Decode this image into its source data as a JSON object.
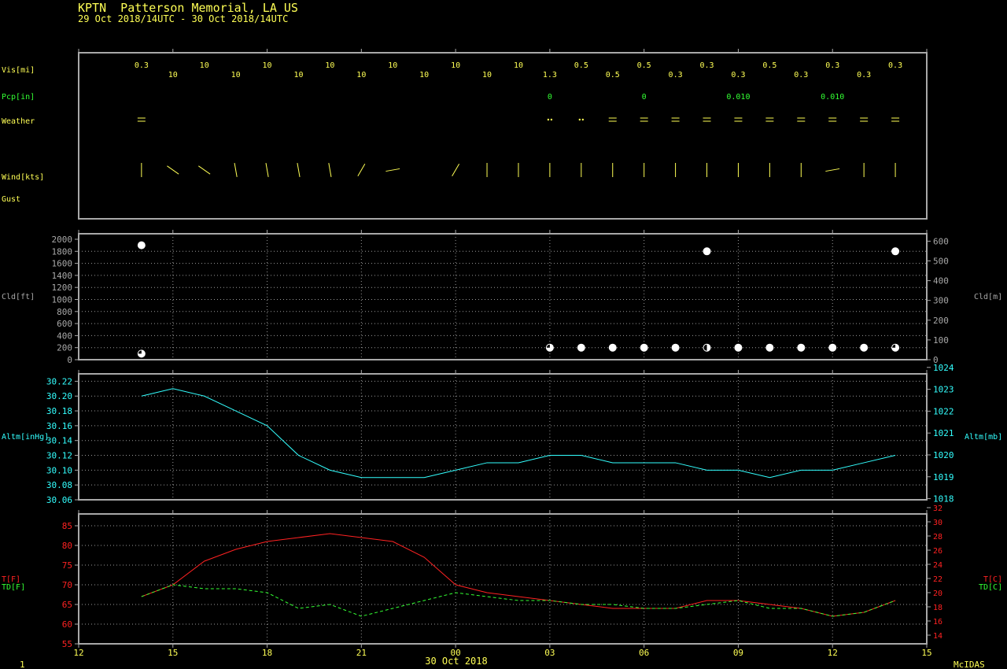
{
  "header": {
    "title": "KPTN  Patterson Memorial, LA US",
    "subtitle": "29 Oct 2018/14UTC - 30 Oct 2018/14UTC"
  },
  "footer": {
    "page": "1",
    "date": "30 Oct 2018",
    "brand": "McIDAS"
  },
  "colors": {
    "yellow": "#ffff55",
    "green": "#33ff33",
    "cyan": "#33ffff",
    "red": "#ff2222",
    "frame": "#a8a8a8"
  },
  "chart_data": [
    {
      "type": "table",
      "name": "surface-obs",
      "x_hours": [
        14,
        15,
        16,
        17,
        18,
        19,
        20,
        21,
        22,
        23,
        24,
        25,
        26,
        27,
        28,
        29,
        30,
        31,
        32,
        33,
        34,
        35,
        36,
        37,
        38
      ],
      "rows": [
        {
          "label": "Vis[mi]",
          "values": [
            "0.3",
            "10",
            "10",
            "10",
            "10",
            "10",
            "10",
            "10",
            "10",
            "10",
            "10",
            "10",
            "10",
            "1.3",
            "0.5",
            "0.5",
            "0.5",
            "0.3",
            "0.3",
            "0.3",
            "0.5",
            "0.3",
            "0.3",
            "0.3",
            "0.3"
          ]
        },
        {
          "label": "Pcp[in]",
          "values": [
            "",
            "",
            "",
            "",
            "",
            "",
            "",
            "",
            "",
            "",
            "",
            "",
            "",
            "0",
            "",
            "",
            "0",
            "",
            "",
            "0.010",
            "",
            "",
            "0.010",
            "",
            ""
          ]
        },
        {
          "label": "Weather",
          "values": [
            "fog",
            "",
            "",
            "",
            "",
            "",
            "",
            "",
            "",
            "",
            "",
            "",
            "",
            "drizzle",
            "drizzle",
            "fog",
            "fog",
            "fog",
            "fog",
            "fog",
            "fog",
            "fog",
            "fog",
            "fog",
            "fog"
          ]
        },
        {
          "label": "Wind[kts]",
          "values": []
        },
        {
          "label": "Gust",
          "values": []
        }
      ],
      "wind_dir_deg": [
        0,
        125,
        125,
        350,
        350,
        350,
        350,
        30,
        80,
        null,
        210,
        0,
        0,
        0,
        0,
        0,
        0,
        0,
        0,
        0,
        0,
        0,
        80,
        0,
        0
      ]
    },
    {
      "type": "scatter",
      "name": "cloud",
      "ylabel_left": "Cld[ft]",
      "ylabel_right": "Cld[m]",
      "ylim": [
        0,
        2000
      ],
      "yticks_left": [
        0,
        200,
        400,
        600,
        800,
        1000,
        1200,
        1400,
        1600,
        1800,
        2000
      ],
      "yticks_right": [
        0,
        100,
        200,
        300,
        400,
        500,
        600
      ],
      "points": [
        {
          "x": 14,
          "y": 1900,
          "cover": "full"
        },
        {
          "x": 14,
          "y": 100,
          "cover": "three-quarter"
        },
        {
          "x": 27,
          "y": 200,
          "cover": "three-quarter"
        },
        {
          "x": 28,
          "y": 200,
          "cover": "full"
        },
        {
          "x": 29,
          "y": 200,
          "cover": "full"
        },
        {
          "x": 30,
          "y": 200,
          "cover": "full"
        },
        {
          "x": 31,
          "y": 200,
          "cover": "full"
        },
        {
          "x": 32,
          "y": 200,
          "cover": "half"
        },
        {
          "x": 32,
          "y": 1800,
          "cover": "full"
        },
        {
          "x": 33,
          "y": 200,
          "cover": "full"
        },
        {
          "x": 34,
          "y": 200,
          "cover": "full"
        },
        {
          "x": 35,
          "y": 200,
          "cover": "full"
        },
        {
          "x": 36,
          "y": 200,
          "cover": "full"
        },
        {
          "x": 37,
          "y": 200,
          "cover": "full"
        },
        {
          "x": 38,
          "y": 200,
          "cover": "three-quarter"
        },
        {
          "x": 38,
          "y": 1800,
          "cover": "full"
        }
      ]
    },
    {
      "type": "line",
      "name": "altimeter",
      "ylabel_left": "Altm[inHg]",
      "ylabel_right": "Altm[mb]",
      "ylim": [
        30.06,
        30.23
      ],
      "yticks_left": [
        "30.06",
        "30.08",
        "30.10",
        "30.12",
        "30.14",
        "30.16",
        "30.18",
        "30.20",
        "30.22"
      ],
      "yticks_right": [
        "1018",
        "1019",
        "1020",
        "1021",
        "1022",
        "1023",
        "1024"
      ],
      "x": [
        14,
        15,
        16,
        17,
        18,
        19,
        20,
        21,
        22,
        23,
        24,
        25,
        26,
        27,
        28,
        29,
        30,
        31,
        32,
        33,
        34,
        35,
        36,
        37,
        38
      ],
      "values": [
        30.2,
        30.21,
        30.2,
        30.18,
        30.16,
        30.12,
        30.1,
        30.09,
        30.09,
        30.09,
        30.1,
        30.11,
        30.11,
        30.12,
        30.12,
        30.11,
        30.11,
        30.11,
        30.1,
        30.1,
        30.09,
        30.1,
        30.1,
        30.11,
        30.12
      ]
    },
    {
      "type": "line",
      "name": "temperature",
      "ylabel_left": [
        "T[F]",
        "TD[F]"
      ],
      "ylabel_right": [
        "T[C]",
        "TD[C]"
      ],
      "ylim": [
        55,
        88
      ],
      "yticks_left": [
        "55",
        "60",
        "65",
        "70",
        "75",
        "80",
        "85"
      ],
      "yticks_right": [
        "14",
        "16",
        "18",
        "20",
        "22",
        "24",
        "26",
        "28",
        "30",
        "32"
      ],
      "x": [
        14,
        15,
        16,
        17,
        18,
        19,
        20,
        21,
        22,
        23,
        24,
        25,
        26,
        27,
        28,
        29,
        30,
        31,
        32,
        33,
        34,
        35,
        36,
        37,
        38
      ],
      "series": [
        {
          "name": "T[F]",
          "values": [
            67,
            70,
            76,
            79,
            81,
            82,
            83,
            82,
            81,
            77,
            70,
            68,
            67,
            66,
            65,
            64,
            64,
            64,
            66,
            66,
            65,
            64,
            62,
            63,
            66
          ]
        },
        {
          "name": "TD[F]",
          "values": [
            67,
            70,
            69,
            69,
            68,
            64,
            65,
            62,
            64,
            66,
            68,
            67,
            66,
            66,
            65,
            65,
            64,
            64,
            65,
            66,
            64,
            64,
            62,
            63,
            66
          ]
        }
      ]
    }
  ],
  "x_axis": {
    "ticks": [
      12,
      15,
      18,
      21,
      24,
      27,
      30,
      33,
      36,
      39
    ],
    "tick_labels": [
      "12",
      "15",
      "18",
      "21",
      "00",
      "03",
      "06",
      "09",
      "12",
      "15"
    ]
  }
}
